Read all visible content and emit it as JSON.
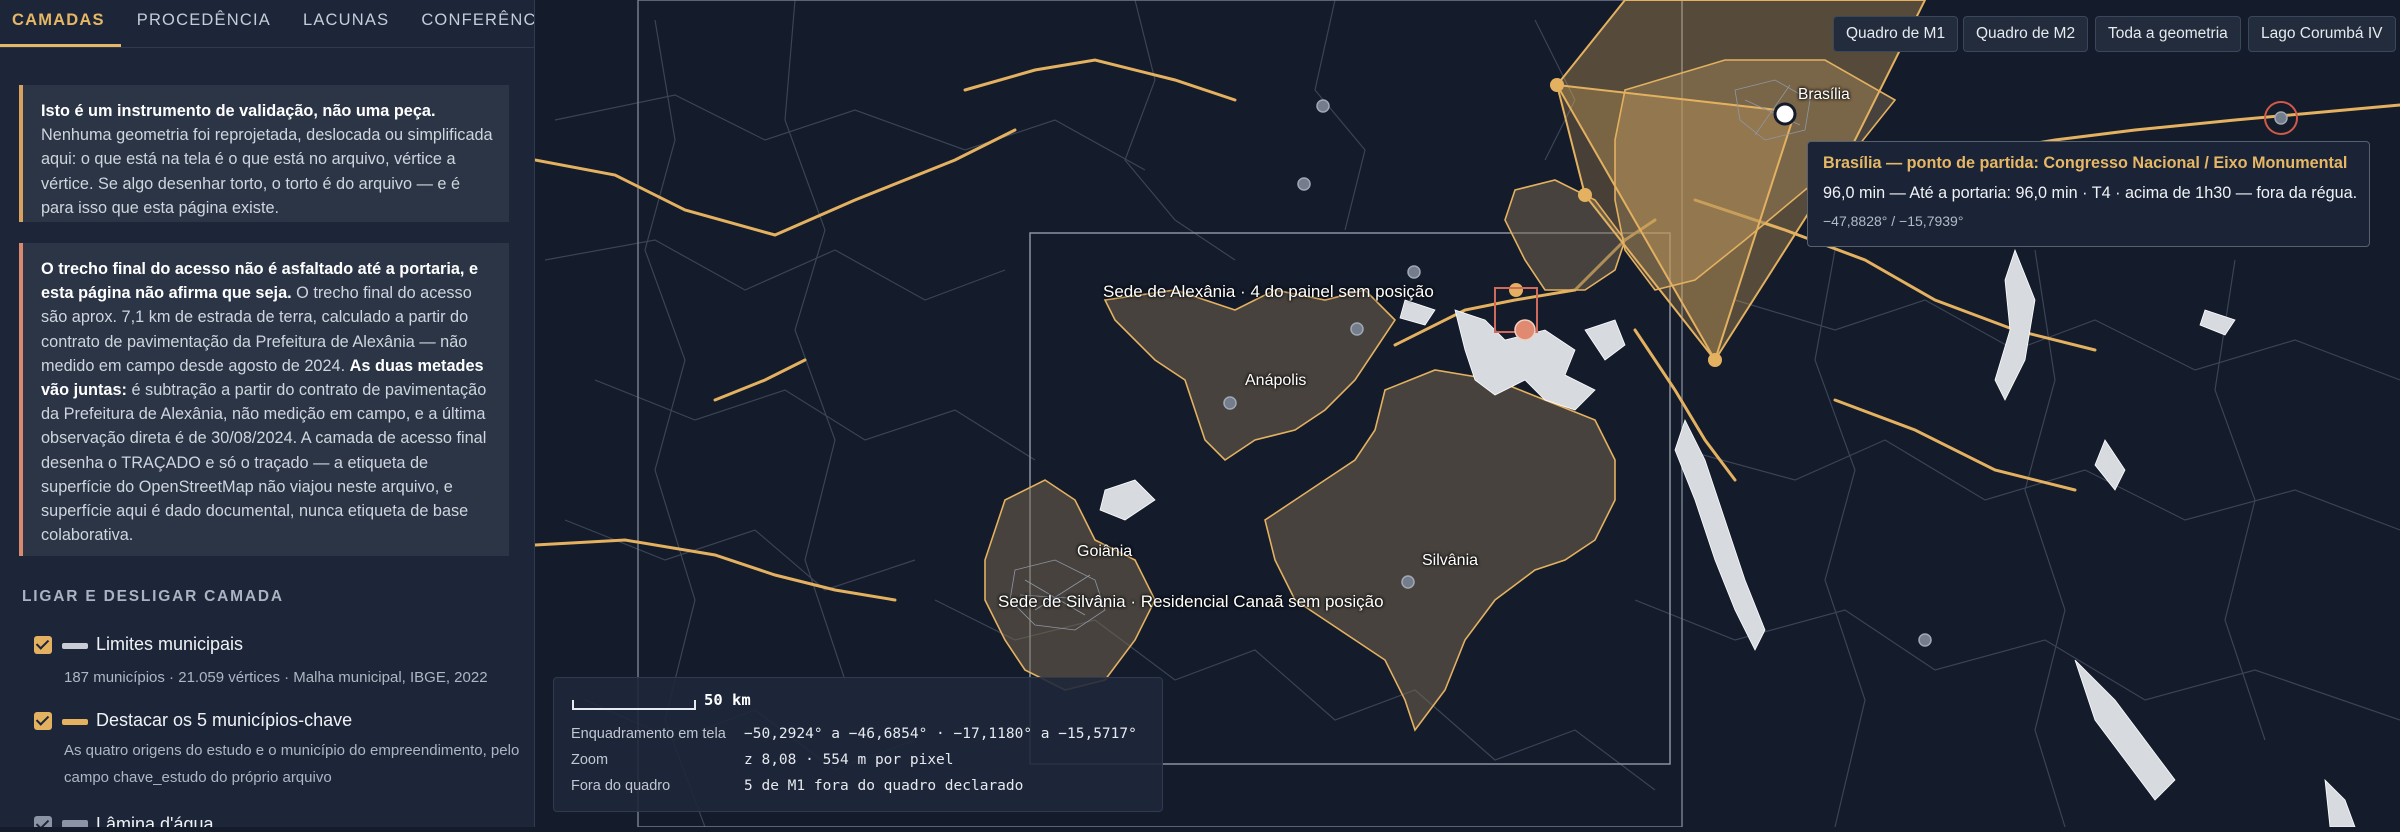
{
  "tabs": [
    {
      "label": "CAMADAS",
      "active": true
    },
    {
      "label": "PROCEDÊNCIA",
      "active": false
    },
    {
      "label": "LACUNAS",
      "active": false
    },
    {
      "label": "CONFERÊNCIAS",
      "active": false
    }
  ],
  "notice1": {
    "bold": "Isto é um instrumento de validação, não uma peça.",
    "text": " Nenhuma geometria foi reprojetada, deslocada ou simplificada aqui: o que está na tela é o que está no arquivo, vértice a vértice. Se algo desenhar torto, o torto é do arquivo — e é para isso que esta página existe."
  },
  "notice2": {
    "bold1": "O trecho final do acesso não é asfaltado até a portaria, e esta página não afirma que seja.",
    "text1": " O trecho final do acesso são aprox. 7,1 km de estrada de terra, calculado a partir do contrato de pavimentação da Prefeitura de Alexânia — não medido em campo desde agosto de 2024. ",
    "bold2": "As duas metades vão juntas:",
    "text2": " é subtração a partir do contrato de pavimentação da Prefeitura de Alexânia, não medição em campo, e a última observação direta é de 30/08/2024. A camada de acesso final desenha o TRAÇADO e só o traçado — a etiqueta de superfície do OpenStreetMap não viajou neste arquivo, e superfície aqui é dado documental, nunca etiqueta de base colaborativa."
  },
  "layers": {
    "heading": "LIGAR E DESLIGAR CAMADA",
    "items": [
      {
        "title": "Limites municipais",
        "desc": "187 municípios · 21.059 vértices · Malha municipal, IBGE, 2022",
        "checked": true,
        "swatch": "#c8ccd4"
      },
      {
        "title": "Destacar os 5 municípios-chave",
        "desc": "As quatro origens do estudo e o município do empreendimento, pelo campo chave_estudo do próprio arquivo",
        "checked": true,
        "swatch": "#e3b160"
      },
      {
        "title": "Lâmina d'água",
        "desc": "",
        "checked": true,
        "swatch": "#8a94a5"
      }
    ]
  },
  "map_buttons": [
    "Quadro de M1",
    "Quadro de M2",
    "Toda a geometria",
    "Lago Corumbá IV"
  ],
  "tooltip": {
    "title": "Brasília — ponto de partida: Congresso Nacional / Eixo Monumental",
    "body": "96,0 min — Até a portaria: 96,0 min · T4 · acima de 1h30 — fora da régua.",
    "coords": "−47,8828° / −15,7939°"
  },
  "map_labels": {
    "brasilia": "Brasília",
    "anapolis": "Anápolis",
    "goiania": "Goiânia",
    "silvania": "Silvânia",
    "sede_alexania": "Sede de Alexânia · 4 do painel sem posição",
    "sede_silvania": "Sede de Silvânia · Residencial Canaã sem posição"
  },
  "info": {
    "scale": "50 km",
    "rows": [
      {
        "label": "Enquadramento em tela",
        "value": "−50,2924° a −46,6854° · −17,1180° a −15,5717°"
      },
      {
        "label": "Zoom",
        "value": "z 8,08 · 554 m por pixel"
      },
      {
        "label": "Fora do quadro",
        "value": "5 de M1 fora do quadro declarado"
      }
    ]
  },
  "colors": {
    "accent": "#e6b765",
    "panel": "#1c2638",
    "map_bg": "#141b2a",
    "warning": "#d88a6e"
  }
}
